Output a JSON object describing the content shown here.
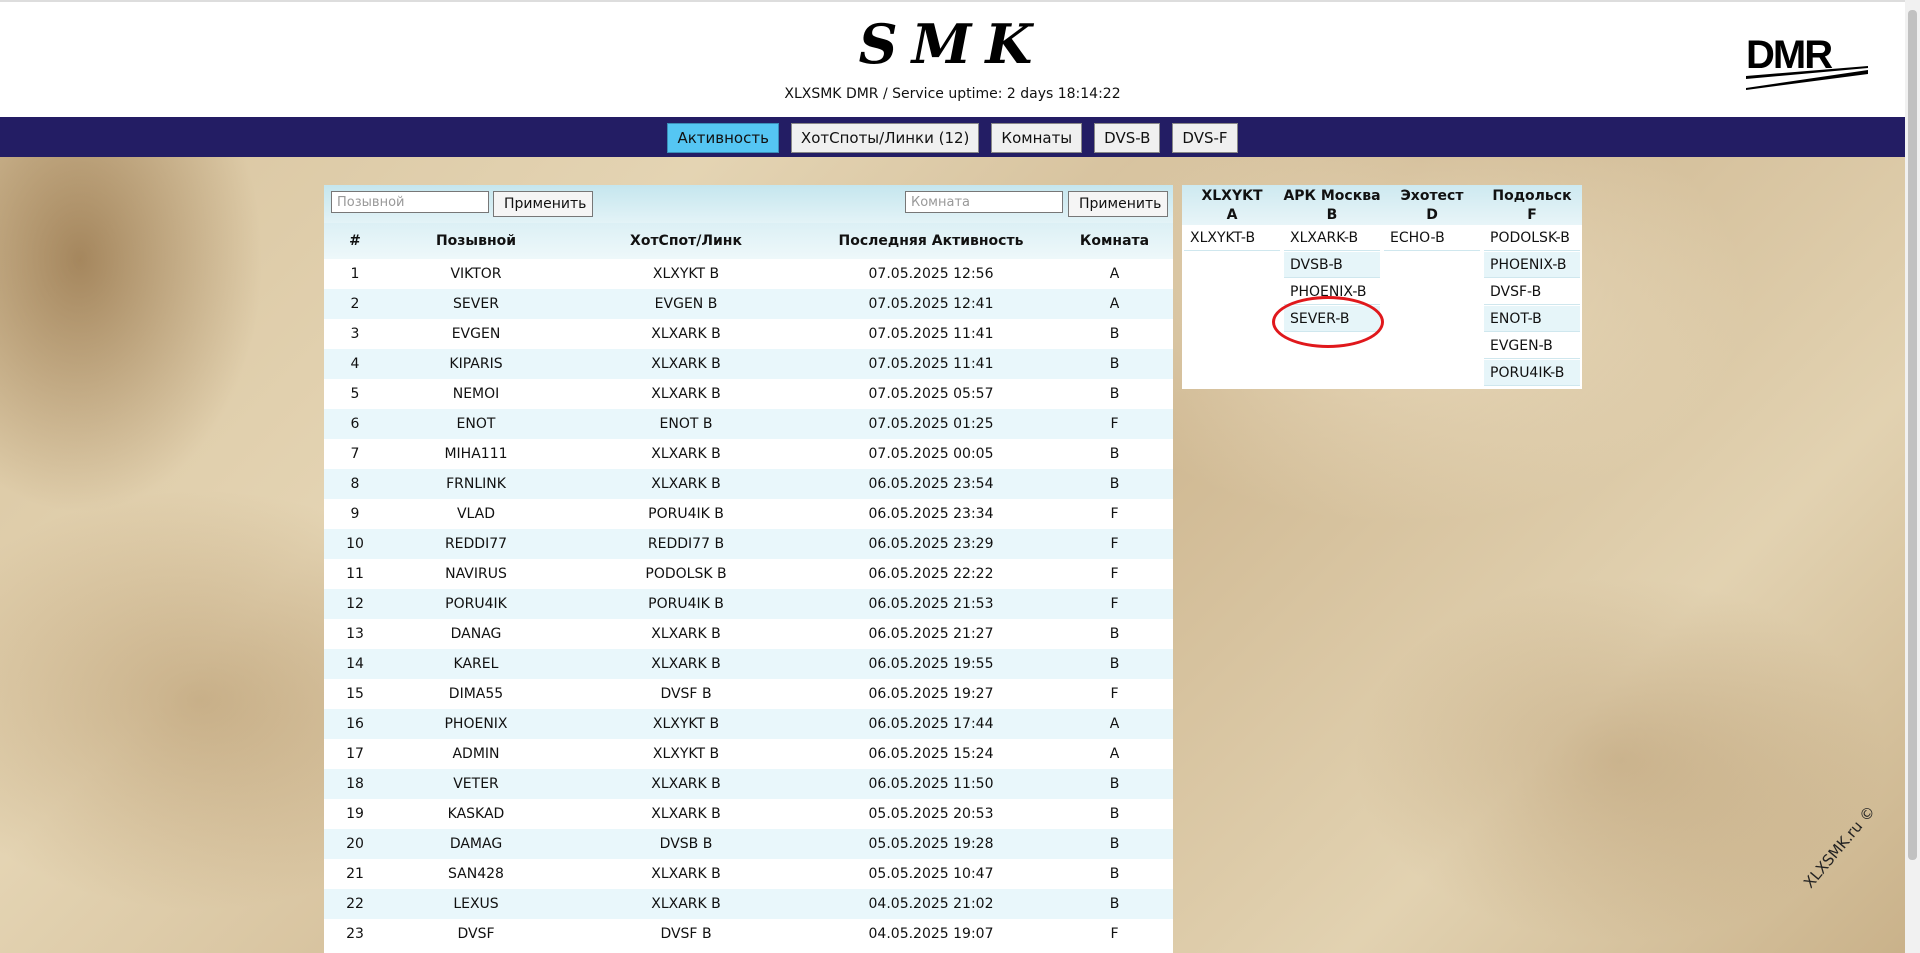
{
  "header": {
    "title": "SMK",
    "subtitle": "XLXSMK  DMR   /  Service uptime: 2 days 18:14:22",
    "logo_text": "DMR"
  },
  "nav": {
    "tabs": [
      {
        "label": "Активность",
        "active": true
      },
      {
        "label": "ХотСпоты/Линки (12)",
        "active": false
      },
      {
        "label": "Комнаты",
        "active": false
      },
      {
        "label": "DVS-B",
        "active": false
      },
      {
        "label": "DVS-F",
        "active": false
      }
    ]
  },
  "filters": {
    "callsign_placeholder": "Позывной",
    "room_placeholder": "Комната",
    "apply_label": "Применить"
  },
  "table": {
    "headers": [
      "#",
      "Позывной",
      "ХотСпот/Линк",
      "Последняя Активность",
      "Комната"
    ],
    "rows": [
      [
        "1",
        "VIKTOR",
        "XLXYKT B",
        "07.05.2025 12:56",
        "A"
      ],
      [
        "2",
        "SEVER",
        "EVGEN B",
        "07.05.2025 12:41",
        "A"
      ],
      [
        "3",
        "EVGEN",
        "XLXARK B",
        "07.05.2025 11:41",
        "B"
      ],
      [
        "4",
        "KIPARIS",
        "XLXARK B",
        "07.05.2025 11:41",
        "B"
      ],
      [
        "5",
        "NEMOI",
        "XLXARK B",
        "07.05.2025 05:57",
        "B"
      ],
      [
        "6",
        "ENOT",
        "ENOT B",
        "07.05.2025 01:25",
        "F"
      ],
      [
        "7",
        "MIHA111",
        "XLXARK B",
        "07.05.2025 00:05",
        "B"
      ],
      [
        "8",
        "FRNLINK",
        "XLXARK B",
        "06.05.2025 23:54",
        "B"
      ],
      [
        "9",
        "VLAD",
        "PORU4IK B",
        "06.05.2025 23:34",
        "F"
      ],
      [
        "10",
        "REDDI77",
        "REDDI77 B",
        "06.05.2025 23:29",
        "F"
      ],
      [
        "11",
        "NAVIRUS",
        "PODOLSK B",
        "06.05.2025 22:22",
        "F"
      ],
      [
        "12",
        "PORU4IK",
        "PORU4IK B",
        "06.05.2025 21:53",
        "F"
      ],
      [
        "13",
        "DANAG",
        "XLXARK B",
        "06.05.2025 21:27",
        "B"
      ],
      [
        "14",
        "KAREL",
        "XLXARK B",
        "06.05.2025 19:55",
        "B"
      ],
      [
        "15",
        "DIMA55",
        "DVSF B",
        "06.05.2025 19:27",
        "F"
      ],
      [
        "16",
        "PHOENIX",
        "XLXYKT B",
        "06.05.2025 17:44",
        "A"
      ],
      [
        "17",
        "ADMIN",
        "XLXYKT B",
        "06.05.2025 15:24",
        "A"
      ],
      [
        "18",
        "VETER",
        "XLXARK B",
        "06.05.2025 11:50",
        "B"
      ],
      [
        "19",
        "KASKAD",
        "XLXARK B",
        "05.05.2025 20:53",
        "B"
      ],
      [
        "20",
        "DAMAG",
        "DVSB B",
        "05.05.2025 19:28",
        "B"
      ],
      [
        "21",
        "SAN428",
        "XLXARK B",
        "05.05.2025 10:47",
        "B"
      ],
      [
        "22",
        "LEXUS",
        "XLXARK B",
        "04.05.2025 21:02",
        "B"
      ],
      [
        "23",
        "DVSF",
        "DVSF B",
        "04.05.2025 19:07",
        "F"
      ]
    ]
  },
  "rooms": [
    {
      "name": "XLXYKT",
      "letter": "A",
      "members": [
        "XLXYKT-B"
      ]
    },
    {
      "name": "АРК Москва",
      "letter": "B",
      "members": [
        "XLXARK-B",
        "DVSB-B",
        "PHOENIX-B",
        "SEVER-B"
      ]
    },
    {
      "name": "Эхотест",
      "letter": "D",
      "members": [
        "ECHO-B"
      ]
    },
    {
      "name": "Подольск",
      "letter": "F",
      "members": [
        "PODOLSK-B",
        "PHOENIX-B",
        "DVSF-B",
        "ENOT-B",
        "EVGEN-B",
        "PORU4IK-B"
      ]
    }
  ],
  "watermark": "XLXSMK.ru ©",
  "colors": {
    "navbar": "#231d64",
    "active_tab": "#55c6f3",
    "highlight_circle": "#e0181c"
  }
}
